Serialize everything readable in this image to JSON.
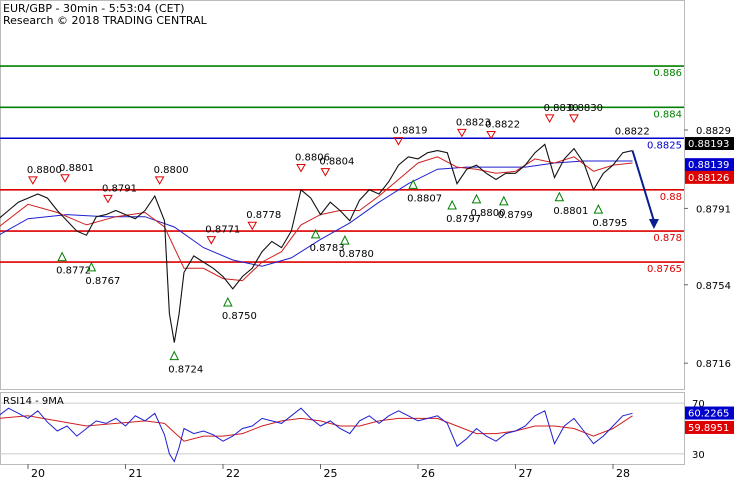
{
  "header": {
    "title": "EUR/GBP - 30min - 5:53:04 (CET)",
    "research": "Research © 2018 TRADING CENTRAL"
  },
  "chart_data": [
    {
      "type": "line",
      "ylim": [
        0.8703,
        0.8892
      ],
      "x_days": [
        {
          "label": "20",
          "x": 0
        },
        {
          "label": "21",
          "x": 1
        },
        {
          "label": "22",
          "x": 2
        },
        {
          "label": "25",
          "x": 3
        },
        {
          "label": "26",
          "x": 4
        },
        {
          "label": "27",
          "x": 5
        },
        {
          "label": "28",
          "x": 6
        }
      ],
      "xlim": [
        -0.3,
        6.7
      ],
      "y_ticks": [
        "0.8829",
        "0.8791",
        "0.8754",
        "0.8716"
      ],
      "levels": [
        {
          "value": 0.886,
          "label": "0.886",
          "color": "#008000"
        },
        {
          "value": 0.884,
          "label": "0.884",
          "color": "#008000"
        },
        {
          "value": 0.8825,
          "label": "0.8825",
          "color": "#0000cc"
        },
        {
          "value": 0.88,
          "label": "0.88",
          "color": "#dd0000"
        },
        {
          "value": 0.878,
          "label": "0.878",
          "color": "#dd0000"
        },
        {
          "value": 0.8765,
          "label": "0.8765",
          "color": "#dd0000"
        }
      ],
      "price_tags": [
        {
          "value": 0.88193,
          "label": "0.88193",
          "bg": "#000000"
        },
        {
          "value": 0.88139,
          "label": "0.88139",
          "bg": "#0000cc"
        },
        {
          "value": 0.88126,
          "label": "0.88126",
          "bg": "#dd0000"
        }
      ],
      "price": {
        "x": [
          -0.3,
          -0.2,
          -0.1,
          0.0,
          0.1,
          0.2,
          0.3,
          0.4,
          0.5,
          0.6,
          0.7,
          0.8,
          0.9,
          1.0,
          1.1,
          1.2,
          1.3,
          1.4,
          1.45,
          1.5,
          1.55,
          1.6,
          1.7,
          1.8,
          1.9,
          2.0,
          2.1,
          2.2,
          2.3,
          2.4,
          2.5,
          2.6,
          2.7,
          2.8,
          2.9,
          3.0,
          3.1,
          3.2,
          3.3,
          3.4,
          3.5,
          3.6,
          3.7,
          3.8,
          3.9,
          4.0,
          4.1,
          4.2,
          4.3,
          4.4,
          4.5,
          4.6,
          4.7,
          4.8,
          4.9,
          5.0,
          5.1,
          5.2,
          5.3,
          5.4,
          5.5,
          5.6,
          5.7,
          5.8,
          5.9,
          6.0,
          6.1,
          6.2
        ],
        "values": [
          0.8786,
          0.879,
          0.8794,
          0.8796,
          0.8798,
          0.8796,
          0.879,
          0.8785,
          0.878,
          0.8778,
          0.8787,
          0.8788,
          0.879,
          0.8788,
          0.8786,
          0.879,
          0.8797,
          0.8785,
          0.874,
          0.8726,
          0.874,
          0.876,
          0.8768,
          0.8765,
          0.8762,
          0.8758,
          0.8752,
          0.8758,
          0.8762,
          0.877,
          0.8775,
          0.8772,
          0.878,
          0.88,
          0.8796,
          0.8788,
          0.8794,
          0.879,
          0.8785,
          0.8795,
          0.88,
          0.8798,
          0.8804,
          0.8812,
          0.8816,
          0.8815,
          0.8818,
          0.8819,
          0.8818,
          0.8803,
          0.881,
          0.8812,
          0.8808,
          0.8805,
          0.8808,
          0.8808,
          0.8812,
          0.8818,
          0.8822,
          0.8806,
          0.8815,
          0.882,
          0.8813,
          0.88,
          0.8808,
          0.8812,
          0.8818,
          0.8819
        ]
      },
      "ma_fast": {
        "x": [
          -0.3,
          0.0,
          0.3,
          0.6,
          0.9,
          1.2,
          1.4,
          1.6,
          1.8,
          2.0,
          2.2,
          2.4,
          2.6,
          2.8,
          3.0,
          3.2,
          3.4,
          3.6,
          3.8,
          4.0,
          4.2,
          4.4,
          4.6,
          4.8,
          5.0,
          5.2,
          5.4,
          5.6,
          5.8,
          6.0,
          6.2
        ],
        "values": [
          0.8782,
          0.8793,
          0.8789,
          0.8783,
          0.8787,
          0.8789,
          0.8782,
          0.8762,
          0.8762,
          0.8757,
          0.8756,
          0.8765,
          0.877,
          0.8783,
          0.8788,
          0.879,
          0.879,
          0.8797,
          0.8805,
          0.8813,
          0.8816,
          0.8811,
          0.881,
          0.8808,
          0.8809,
          0.8815,
          0.8813,
          0.8816,
          0.8809,
          0.8812,
          0.8813
        ]
      },
      "ma_slow": {
        "x": [
          -0.3,
          0.0,
          0.4,
          0.8,
          1.2,
          1.5,
          1.8,
          2.1,
          2.4,
          2.7,
          3.0,
          3.3,
          3.6,
          3.9,
          4.2,
          4.5,
          4.8,
          5.1,
          5.4,
          5.7,
          6.0,
          6.2
        ],
        "values": [
          0.8778,
          0.8786,
          0.8788,
          0.8787,
          0.8787,
          0.8782,
          0.8772,
          0.8766,
          0.8763,
          0.8767,
          0.8776,
          0.8784,
          0.8794,
          0.8803,
          0.881,
          0.8811,
          0.8811,
          0.8811,
          0.8813,
          0.8814,
          0.8814,
          0.8814
        ]
      },
      "forecast": {
        "from": [
          6.2,
          0.8819
        ],
        "to": [
          6.42,
          0.8781
        ]
      },
      "annotations": [
        {
          "label": "0.8800",
          "x": 0.05,
          "y": 0.88,
          "kind": "high"
        },
        {
          "label": "0.8801",
          "x": 0.38,
          "y": 0.8801,
          "kind": "high"
        },
        {
          "label": "0.8791",
          "x": 0.82,
          "y": 0.8791,
          "kind": "high"
        },
        {
          "label": "0.8800",
          "x": 1.35,
          "y": 0.88,
          "kind": "high"
        },
        {
          "label": "0.8771",
          "x": 1.88,
          "y": 0.8771,
          "kind": "high"
        },
        {
          "label": "0.8778",
          "x": 2.3,
          "y": 0.8778,
          "kind": "high"
        },
        {
          "label": "0.8806",
          "x": 2.8,
          "y": 0.8806,
          "kind": "high"
        },
        {
          "label": "0.8804",
          "x": 3.05,
          "y": 0.8804,
          "kind": "high"
        },
        {
          "label": "0.8819",
          "x": 3.8,
          "y": 0.8819,
          "kind": "high"
        },
        {
          "label": "0.8823",
          "x": 4.45,
          "y": 0.8823,
          "kind": "high"
        },
        {
          "label": "0.8822",
          "x": 4.75,
          "y": 0.8822,
          "kind": "high"
        },
        {
          "label": "0.8830",
          "x": 5.35,
          "y": 0.883,
          "kind": "high"
        },
        {
          "label": "0.8830",
          "x": 5.6,
          "y": 0.883,
          "kind": "high"
        },
        {
          "label": "0.8822",
          "x": 6.1,
          "y": 0.8822,
          "kind": "note"
        },
        {
          "label": "0.8772",
          "x": 0.35,
          "y": 0.8772,
          "kind": "low"
        },
        {
          "label": "0.8767",
          "x": 0.65,
          "y": 0.8767,
          "kind": "low"
        },
        {
          "label": "0.8724",
          "x": 1.5,
          "y": 0.8724,
          "kind": "low"
        },
        {
          "label": "0.8750",
          "x": 2.05,
          "y": 0.875,
          "kind": "low"
        },
        {
          "label": "0.8783",
          "x": 2.95,
          "y": 0.8783,
          "kind": "low"
        },
        {
          "label": "0.8780",
          "x": 3.25,
          "y": 0.878,
          "kind": "low"
        },
        {
          "label": "0.8807",
          "x": 3.95,
          "y": 0.8807,
          "kind": "low"
        },
        {
          "label": "0.8797",
          "x": 4.35,
          "y": 0.8797,
          "kind": "low"
        },
        {
          "label": "0.8800",
          "x": 4.6,
          "y": 0.88,
          "kind": "low"
        },
        {
          "label": "0.8799",
          "x": 4.88,
          "y": 0.8799,
          "kind": "low"
        },
        {
          "label": "0.8801",
          "x": 5.45,
          "y": 0.8801,
          "kind": "low"
        },
        {
          "label": "0.8795",
          "x": 5.85,
          "y": 0.8795,
          "kind": "low"
        }
      ]
    },
    {
      "type": "line",
      "title": "RSI14 - 9MA",
      "ylim": [
        22,
        78
      ],
      "y_ticks": [
        "70",
        "30"
      ],
      "tags": [
        {
          "value": 60.2265,
          "label": "60.2265",
          "bg": "#0000cc"
        },
        {
          "value": 59.8951,
          "label": "59.8951",
          "bg": "#dd0000"
        }
      ],
      "rsi": {
        "x": [
          -0.3,
          -0.2,
          -0.1,
          0.0,
          0.1,
          0.2,
          0.3,
          0.4,
          0.5,
          0.6,
          0.7,
          0.8,
          0.9,
          1.0,
          1.1,
          1.2,
          1.3,
          1.4,
          1.45,
          1.5,
          1.55,
          1.6,
          1.7,
          1.8,
          1.9,
          2.0,
          2.1,
          2.2,
          2.3,
          2.4,
          2.5,
          2.6,
          2.7,
          2.8,
          2.9,
          3.0,
          3.1,
          3.2,
          3.3,
          3.4,
          3.5,
          3.6,
          3.7,
          3.8,
          3.9,
          4.0,
          4.1,
          4.2,
          4.3,
          4.4,
          4.5,
          4.6,
          4.7,
          4.8,
          4.9,
          5.0,
          5.1,
          5.2,
          5.3,
          5.4,
          5.5,
          5.6,
          5.7,
          5.8,
          5.9,
          6.0,
          6.1,
          6.2
        ],
        "values": [
          60,
          66,
          62,
          58,
          64,
          55,
          48,
          52,
          44,
          50,
          56,
          54,
          58,
          52,
          60,
          56,
          62,
          45,
          30,
          24,
          35,
          50,
          46,
          48,
          45,
          40,
          44,
          50,
          52,
          58,
          56,
          54,
          60,
          66,
          58,
          52,
          56,
          50,
          46,
          56,
          60,
          54,
          60,
          64,
          60,
          56,
          58,
          60,
          54,
          36,
          42,
          50,
          44,
          40,
          46,
          48,
          52,
          60,
          64,
          38,
          52,
          58,
          48,
          38,
          44,
          52,
          60,
          62
        ]
      },
      "rsi_ma": {
        "x": [
          -0.3,
          0.0,
          0.3,
          0.6,
          0.9,
          1.2,
          1.4,
          1.6,
          1.8,
          2.0,
          2.2,
          2.4,
          2.6,
          2.8,
          3.0,
          3.2,
          3.4,
          3.6,
          3.8,
          4.0,
          4.2,
          4.4,
          4.6,
          4.8,
          5.0,
          5.2,
          5.4,
          5.6,
          5.8,
          6.0,
          6.2
        ],
        "values": [
          58,
          60,
          56,
          52,
          54,
          56,
          54,
          40,
          44,
          44,
          46,
          52,
          56,
          58,
          56,
          52,
          52,
          56,
          58,
          58,
          58,
          52,
          46,
          46,
          48,
          52,
          52,
          50,
          44,
          50,
          60
        ]
      }
    }
  ]
}
